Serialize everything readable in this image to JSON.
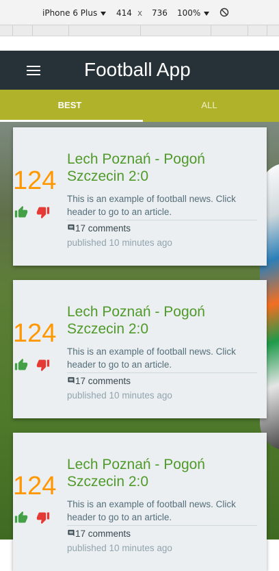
{
  "devtools": {
    "device": "iPhone 6 Plus",
    "width": "414",
    "separator": "x",
    "height": "736",
    "zoom": "100%"
  },
  "app": {
    "title": "Football App"
  },
  "tabs": [
    {
      "label": "BEST",
      "active": true
    },
    {
      "label": "ALL",
      "active": false
    }
  ],
  "colors": {
    "appbar": "#263238",
    "tabs": "#b0b32a",
    "score": "#ff9800",
    "headline": "#4f9a2a",
    "thumb_up": "#43a047",
    "thumb_down": "#e53935"
  },
  "news": [
    {
      "score": "124",
      "headline": "Lech Poznań - Pogoń Szczecin 2:0",
      "excerpt": "This is an example of football news. Click header to go to an article.",
      "comments": "17 comments",
      "published": "published 10 minutes ago"
    },
    {
      "score": "124",
      "headline": "Lech Poznań - Pogoń Szczecin 2:0",
      "excerpt": "This is an example of football news. Click header to go to an article.",
      "comments": "17 comments",
      "published": "published 10 minutes ago"
    },
    {
      "score": "124",
      "headline": "Lech Poznań - Pogoń Szczecin 2:0",
      "excerpt": "This is an example of football news. Click header to go to an article.",
      "comments": "17 comments",
      "published": "published 10 minutes ago"
    }
  ]
}
